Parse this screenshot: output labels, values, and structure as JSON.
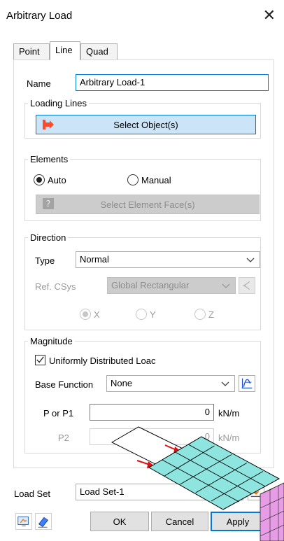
{
  "dialog": {
    "title": "Arbitrary Load"
  },
  "tabs": [
    {
      "label": "Point",
      "active": false
    },
    {
      "label": "Line",
      "active": true
    },
    {
      "label": "Quad",
      "active": false
    }
  ],
  "name": {
    "label": "Name",
    "value": "Arbitrary Load-1"
  },
  "loading_lines": {
    "legend": "Loading Lines",
    "select_button": "Select Object(s)"
  },
  "elements": {
    "legend": "Elements",
    "auto_label": "Auto",
    "manual_label": "Manual",
    "auto_selected": true,
    "select_face_button": "Select Element Face(s)"
  },
  "direction": {
    "legend": "Direction",
    "type_label": "Type",
    "type_value": "Normal",
    "refcsys_label": "Ref. CSys",
    "refcsys_value": "Global Rectangular",
    "axes": [
      "X",
      "Y",
      "Z"
    ],
    "selected_axis": "X"
  },
  "magnitude": {
    "legend": "Magnitude",
    "uniform_label": "Uniformly Distributed Loac",
    "uniform_checked": true,
    "base_function_label": "Base Function",
    "base_function_value": "None",
    "p1_label": "P or P1",
    "p1_value": "0",
    "p1_unit": "kN/m",
    "p2_label": "P2",
    "p2_value": "0",
    "p2_unit": "kN/m"
  },
  "load_set": {
    "label": "Load Set",
    "value": "Load Set-1"
  },
  "footer": {
    "ok": "OK",
    "cancel": "Cancel",
    "apply": "Apply"
  },
  "colors": {
    "accent": "#0078d7",
    "select_button_bg": "#cce4f7",
    "mesh_fill": "#8ee5e0",
    "solid_fill": "#e79de6"
  }
}
